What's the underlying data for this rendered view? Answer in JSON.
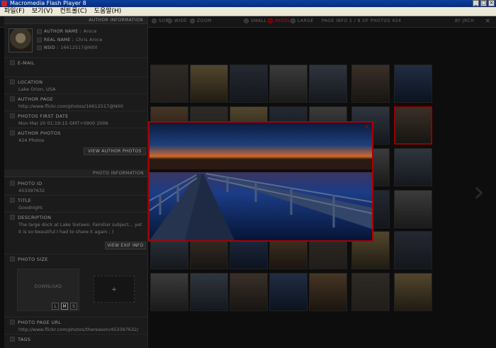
{
  "window": {
    "title": "Macromedia Flash Player 8"
  },
  "menu": [
    "파일(F)",
    "보기(V)",
    "컨트롤(C)",
    "도움말(H)"
  ],
  "topbar": {
    "items": [
      {
        "label": "SORT",
        "active": false
      },
      {
        "label": "WIDE",
        "active": false
      },
      {
        "label": "ZOOM",
        "active": false
      },
      {
        "label": "SMALL",
        "active": false
      },
      {
        "label": "MIDDLE",
        "active": true
      },
      {
        "label": "LARGE",
        "active": false
      }
    ],
    "page_info": "PAGE INFO  2 / 8 OF PHOTOS  424",
    "login": "BY JRCH"
  },
  "author_info": {
    "section_title": "AUTHOR INFORMATION",
    "author_name_label": "AUTHOR NAME :",
    "author_name": "Aroce",
    "real_name_label": "REAL NAME :",
    "real_name": "Chris Aroce",
    "nsid_label": "NSID :",
    "nsid": "16612517@N00",
    "email_label": "E-MAIL",
    "location_label": "LOCATION",
    "location": "Lake Orion, USA",
    "author_page_label": "AUTHOR PAGE",
    "author_page": "http://www.flickr.com/photos/16612517@N00",
    "photos_first_date_label": "PHOTOS FIRST DATE",
    "photos_first_date": "Mon Mar 20 01:19:15 GMT+0900 2006",
    "author_photos_label": "AUTHOR PHOTOS",
    "author_photos": "424 Photos",
    "view_author_photos": "VIEW AUTHOR PHOTOS"
  },
  "photo_info": {
    "section_title": "PHOTO INFORMATION",
    "photo_id_label": "PHOTO ID",
    "photo_id": "453397632",
    "title_label": "TITLE",
    "title": "Goodnight",
    "description_label": "DESCRIPTION",
    "description": "The large dock at Lake Sixteen. Familiar subject... yet it is so beautiful I had to share it again ; )",
    "view_exif": "VIEW EXIF INFO",
    "photo_size_label": "PHOTO SIZE",
    "download": "DOWNLOAD",
    "sizes": [
      "L",
      "M",
      "S"
    ],
    "plus": "+",
    "photo_page_url_label": "PHOTO PAGE URL",
    "photo_page_url": "http://www.flickr.com/photos/thereason/453397632/",
    "tags_label": "TAGS"
  },
  "popup": {
    "close": "×"
  },
  "colors": {
    "accent": "#b00000",
    "panel": "#1b1b1b",
    "background": "#111111"
  }
}
